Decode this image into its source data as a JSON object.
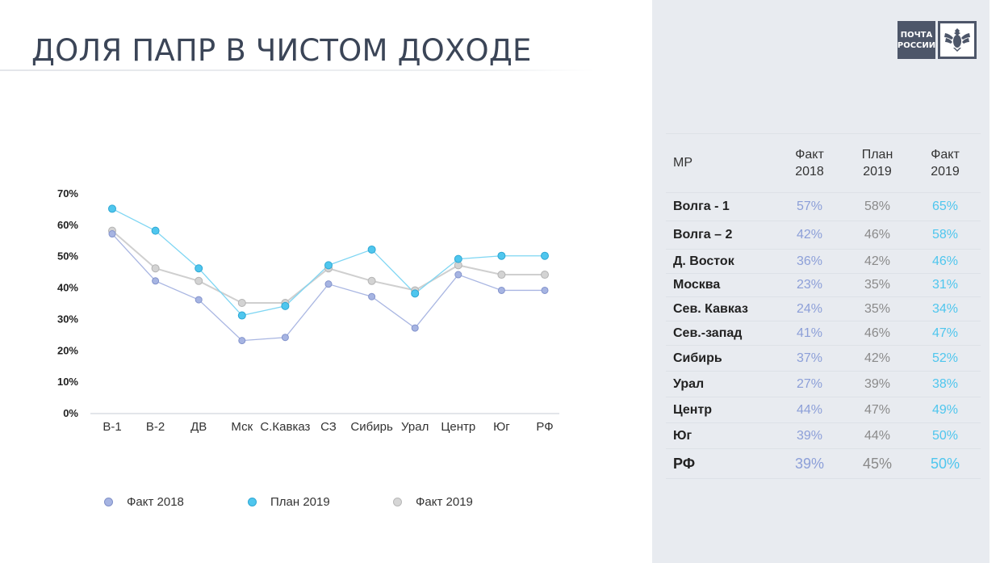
{
  "header": {
    "title": "ДОЛЯ ПАПР В ЧИСТОМ ДОХОДЕ"
  },
  "logo": {
    "line1": "ПОЧТА",
    "line2": "РОССИИ",
    "icon": "eagle-emblem-icon"
  },
  "colors": {
    "fact2018": "#a6b4e2",
    "plan2019": "#4fc6ee",
    "fact2019": "#cfcfcf",
    "panel": "#e8ebf0"
  },
  "chart_data": {
    "type": "line",
    "categories": [
      "В-1",
      "В-2",
      "ДВ",
      "Мск",
      "С.Кавказ",
      "СЗ",
      "Сибирь",
      "Урал",
      "Центр",
      "Юг",
      "РФ"
    ],
    "yticks": [
      "0%",
      "10%",
      "20%",
      "30%",
      "40%",
      "50%",
      "60%",
      "70%"
    ],
    "ylim": [
      0,
      70
    ],
    "legend_position": "bottom",
    "series": [
      {
        "name": "Факт 2018",
        "color": "#a6b4e2",
        "values": [
          57,
          42,
          36,
          23,
          24,
          41,
          37,
          27,
          44,
          39,
          39
        ]
      },
      {
        "name": "План 2019",
        "color": "#4fc6ee",
        "values": [
          65,
          58,
          46,
          31,
          34,
          47,
          52,
          38,
          49,
          50,
          50
        ]
      },
      {
        "name": "Факт 2019",
        "color": "#cfcfcf",
        "values": [
          58,
          46,
          42,
          35,
          35,
          46,
          42,
          39,
          47,
          44,
          44
        ]
      }
    ]
  },
  "table": {
    "headers": {
      "region": "МР",
      "fact2018": [
        "Факт",
        "2018"
      ],
      "plan2019": [
        "План",
        "2019"
      ],
      "fact2019": [
        "Факт",
        "2019"
      ]
    },
    "rows": [
      {
        "name": "Волга - 1",
        "fact2018": "57%",
        "plan2019": "58%",
        "fact2019": "65%"
      },
      {
        "name": "Волга – 2",
        "fact2018": "42%",
        "plan2019": "46%",
        "fact2019": "58%"
      },
      {
        "name": "Д. Восток",
        "fact2018": "36%",
        "plan2019": "42%",
        "fact2019": "46%"
      },
      {
        "name": "Москва",
        "fact2018": "23%",
        "plan2019": "35%",
        "fact2019": "31%"
      },
      {
        "name": "Сев. Кавказ",
        "fact2018": "24%",
        "plan2019": "35%",
        "fact2019": "34%"
      },
      {
        "name": "Сев.-запад",
        "fact2018": "41%",
        "plan2019": "46%",
        "fact2019": "47%"
      },
      {
        "name": "Сибирь",
        "fact2018": "37%",
        "plan2019": "42%",
        "fact2019": "52%"
      },
      {
        "name": "Урал",
        "fact2018": "27%",
        "plan2019": "39%",
        "fact2019": "38%"
      },
      {
        "name": "Центр",
        "fact2018": "44%",
        "plan2019": "47%",
        "fact2019": "49%"
      },
      {
        "name": "Юг",
        "fact2018": "39%",
        "plan2019": "44%",
        "fact2019": "50%"
      },
      {
        "name": "РФ",
        "fact2018": "39%",
        "plan2019": "45%",
        "fact2019": "50%"
      }
    ]
  }
}
